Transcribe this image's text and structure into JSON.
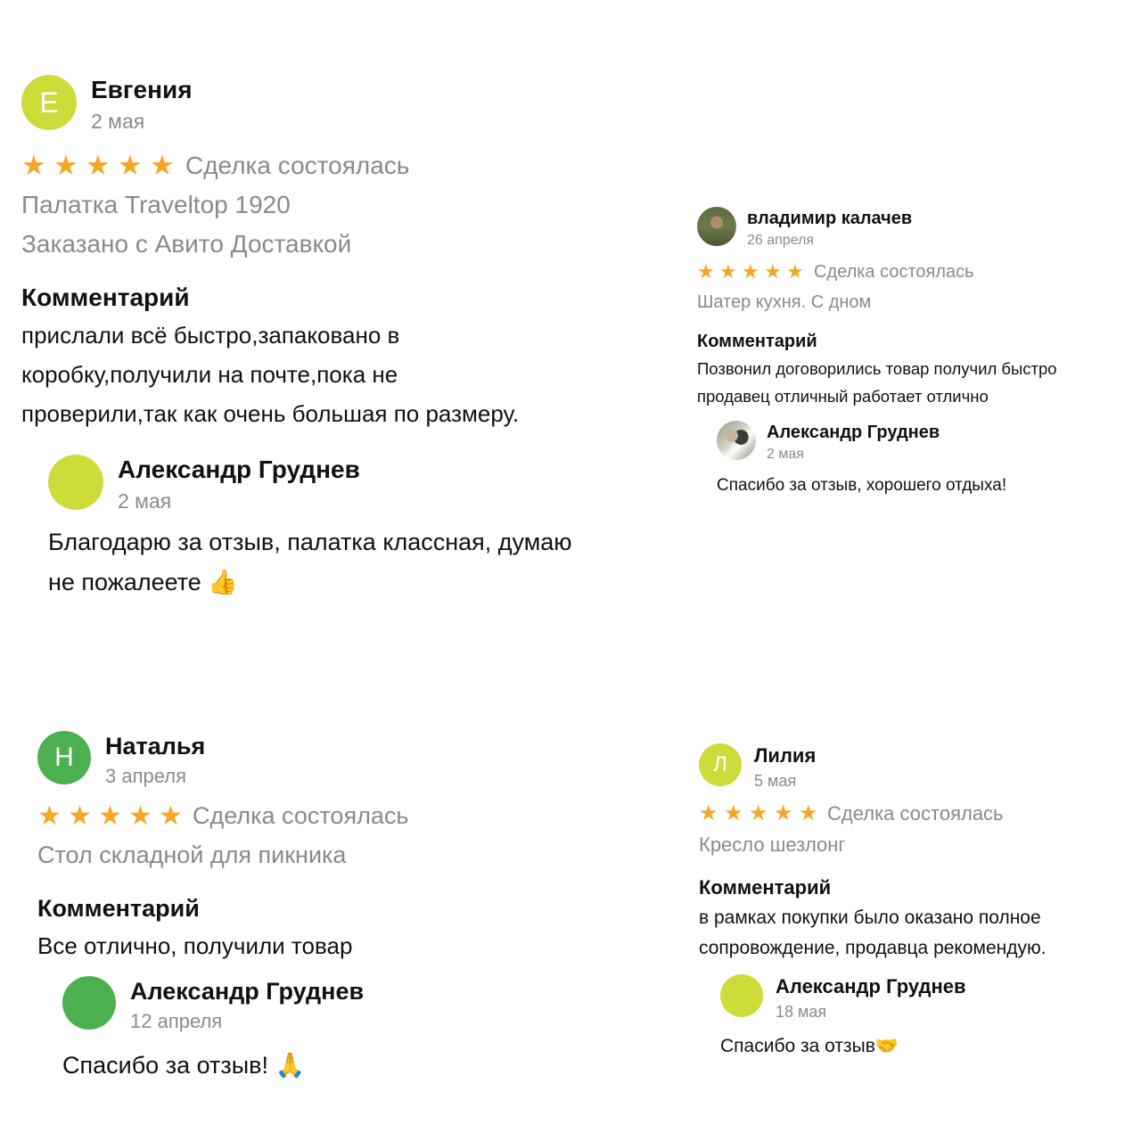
{
  "colors": {
    "star": "#f5a623",
    "avatar_yellow_green": "#cddc39",
    "avatar_green": "#4caf50",
    "muted": "#8a8a8a"
  },
  "reviews": [
    {
      "author": "Евгения",
      "avatar_letter": "Е",
      "date": "2 мая",
      "rating": 5,
      "status": "Сделка состоялась",
      "item": "Палатка Traveltop 1920",
      "delivery": "Заказано с Авито Доставкой",
      "comment_label": "Комментарий",
      "comment_lines": [
        "прислали всё быстро,запаковано в",
        "коробку,получили на почте,пока не",
        "проверили,так как очень большая по размеру."
      ],
      "reply": {
        "author": "Александр Груднев",
        "date": "2 мая",
        "text_lines": [
          "Благодарю за отзыв, палатка классная, думаю",
          "не пожалеете"
        ],
        "emoji": "👍"
      }
    },
    {
      "author": "владимир калачев",
      "date": "26 апреля",
      "rating": 5,
      "status": "Сделка состоялась",
      "item": "Шатер кухня. С дном",
      "comment_label": "Комментарий",
      "comment_lines": [
        "Позвонил договорились товар получил быстро",
        "продавец отличный работает отлично"
      ],
      "reply": {
        "author": "Александр Груднев",
        "date": "2 мая",
        "text_lines": [
          "Спасибо за отзыв, хорошего отдыха!"
        ]
      }
    },
    {
      "author": "Наталья",
      "avatar_letter": "Н",
      "date": "3 апреля",
      "rating": 5,
      "status": "Сделка состоялась",
      "item": "Стол складной для пикника",
      "comment_label": "Комментарий",
      "comment_lines": [
        "Все отлично, получили товар"
      ],
      "reply": {
        "author": "Александр Груднев",
        "date": "12 апреля",
        "text_lines": [
          "Спасибо за отзыв! "
        ],
        "emoji": "🙏"
      }
    },
    {
      "author": "Лилия",
      "avatar_letter": "Л",
      "date": "5 мая",
      "rating": 5,
      "status": "Сделка состоялась",
      "item": "Кресло шезлонг",
      "comment_label": "Комментарий",
      "comment_lines": [
        "в рамках покупки было оказано полное",
        "сопровождение, продавца рекомендую."
      ],
      "reply": {
        "author": "Александр Груднев",
        "date": "18 мая",
        "text_lines": [
          "Спасибо за отзыв"
        ],
        "emoji": "🤝"
      }
    }
  ]
}
